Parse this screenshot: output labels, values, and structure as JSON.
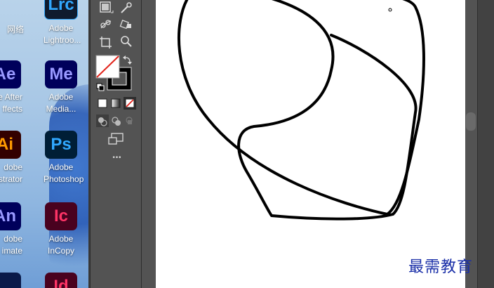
{
  "desktop": {
    "icons": [
      {
        "text": "",
        "label1": "网络",
        "label2": ""
      },
      {
        "text": "Lrc",
        "label1": "Adobe",
        "label2": "Lightroo...",
        "bg": "#0f1b2e",
        "fg": "#31a8ff"
      },
      {
        "text": "Ae",
        "label1": "be After",
        "label2": "ffects",
        "bg": "#00005b",
        "fg": "#9999ff"
      },
      {
        "text": "Me",
        "label1": "Adobe",
        "label2": "Media...",
        "bg": "#00005b",
        "fg": "#9999ff"
      },
      {
        "text": "Ai",
        "label1": "dobe",
        "label2": "strator",
        "bg": "#330000",
        "fg": "#ff9a00"
      },
      {
        "text": "Ps",
        "label1": "Adobe",
        "label2": "Photoshop",
        "bg": "#001e36",
        "fg": "#31a8ff"
      },
      {
        "text": "An",
        "label1": "dobe",
        "label2": "imate",
        "bg": "#00005b",
        "fg": "#9999ff"
      },
      {
        "text": "Ic",
        "label1": "Adobe",
        "label2": "InCopy",
        "bg": "#49021f",
        "fg": "#ff3366"
      },
      {
        "text": "",
        "label1": "",
        "label2": "",
        "bg": "#0a1a4a",
        "fg": "#9999ff"
      },
      {
        "text": "Id",
        "label1": "",
        "label2": "",
        "bg": "#49021f",
        "fg": "#ff3366"
      }
    ]
  },
  "toolbar": {
    "more_label": "•••"
  },
  "watermark": "最需教育",
  "colors": {
    "toolbar_bg": "#535353",
    "artboard": "#ffffff",
    "stroke": "#000000",
    "watermark": "#1a2fa8"
  }
}
